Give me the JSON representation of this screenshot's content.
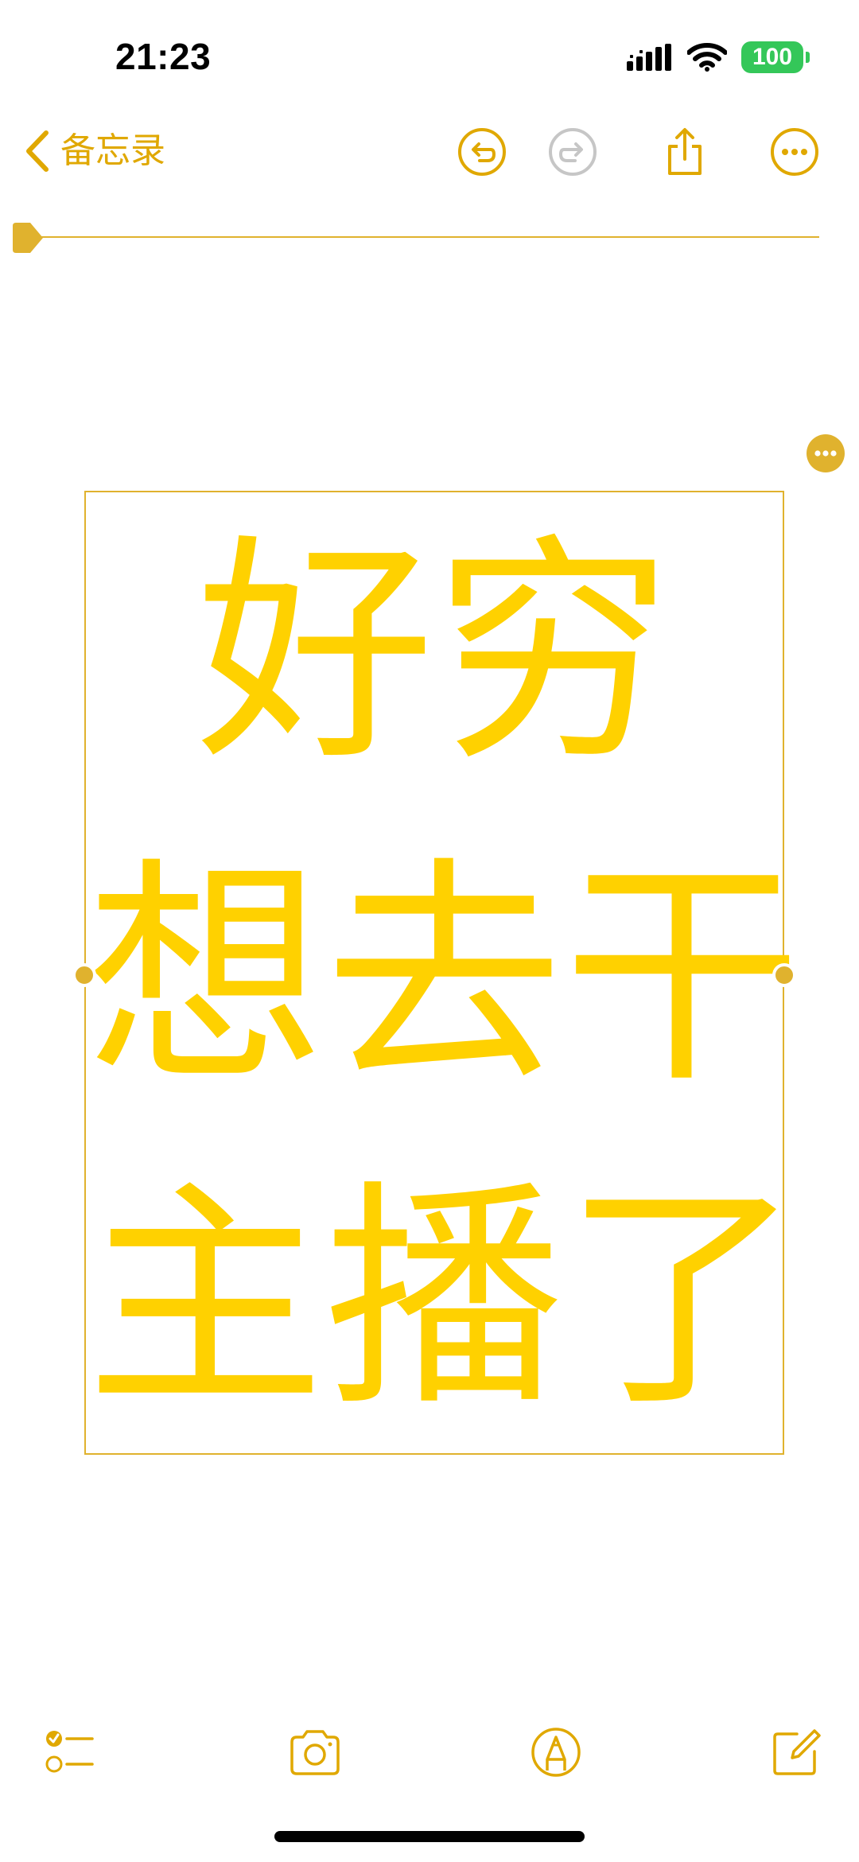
{
  "status_bar": {
    "time": "21:23",
    "battery": "100",
    "battery_color": "#34c759"
  },
  "nav": {
    "back_label": "备忘录",
    "accent_color": "#e0a800",
    "icons": [
      "undo-icon",
      "redo-icon",
      "share-icon",
      "more-icon"
    ]
  },
  "note": {
    "lines": [
      "好穷",
      "想去干",
      "主播了"
    ],
    "text_color": "#ffd100"
  },
  "toolbar": {
    "icons": [
      "checklist-icon",
      "camera-icon",
      "markup-icon",
      "compose-icon"
    ]
  }
}
